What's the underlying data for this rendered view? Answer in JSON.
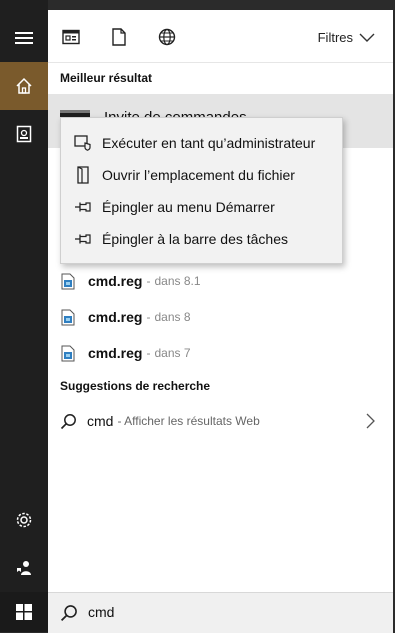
{
  "filters": {
    "label": "Filtres"
  },
  "sections": {
    "best_match": "Meilleur résultat",
    "suggestions": "Suggestions de recherche"
  },
  "best_result": {
    "label": "Invite de commandes"
  },
  "context_menu": {
    "items": [
      {
        "label": "Exécuter en tant qu’administrateur",
        "icon": "run-as-admin-icon"
      },
      {
        "label": "Ouvrir l’emplacement du fichier",
        "icon": "file-location-icon"
      },
      {
        "label": "Épingler au menu Démarrer",
        "icon": "pin-icon"
      },
      {
        "label": "Épingler à la barre des tâches",
        "icon": "pin-icon"
      }
    ]
  },
  "results": [
    {
      "name": "cmd.reg",
      "sep": "-",
      "location": "dans 8.1"
    },
    {
      "name": "cmd.reg",
      "sep": "-",
      "location": "dans 8"
    },
    {
      "name": "cmd.reg",
      "sep": "-",
      "location": "dans 7"
    }
  ],
  "web_suggestion": {
    "query": "cmd",
    "hint": "- Afficher les résultats Web"
  },
  "search": {
    "value": "cmd"
  },
  "colors": {
    "rail": "#1f1f1f",
    "home_accent": "#7a5a2c",
    "panel": "#ffffff",
    "highlight": "#e4e4e4"
  }
}
